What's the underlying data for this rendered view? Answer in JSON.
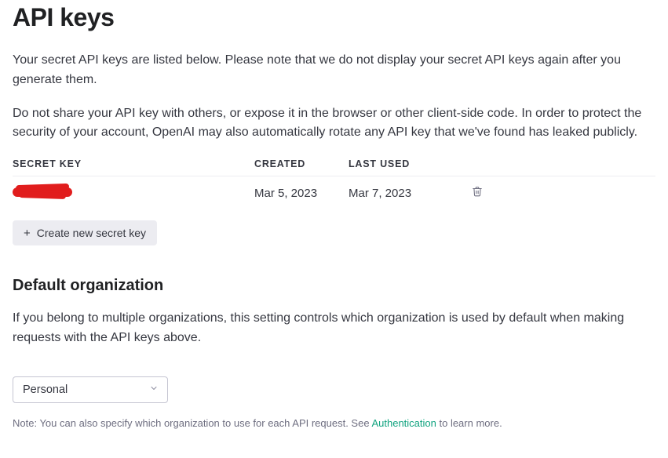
{
  "page": {
    "title": "API keys",
    "intro1": "Your secret API keys are listed below. Please note that we do not display your secret API keys again after you generate them.",
    "intro2": "Do not share your API key with others, or expose it in the browser or other client-side code. In order to protect the security of your account, OpenAI may also automatically rotate any API key that we've found has leaked publicly."
  },
  "table": {
    "headers": {
      "secret_key": "SECRET KEY",
      "created": "CREATED",
      "last_used": "LAST USED"
    },
    "rows": [
      {
        "created": "Mar 5, 2023",
        "last_used": "Mar 7, 2023"
      }
    ]
  },
  "buttons": {
    "create_new": "Create new secret key"
  },
  "org": {
    "heading": "Default organization",
    "description": "If you belong to multiple organizations, this setting controls which organization is used by default when making requests with the API keys above.",
    "selected": "Personal"
  },
  "note": {
    "prefix": "Note: You can also specify which organization to use for each API request. See ",
    "link_text": "Authentication",
    "suffix": " to learn more."
  }
}
